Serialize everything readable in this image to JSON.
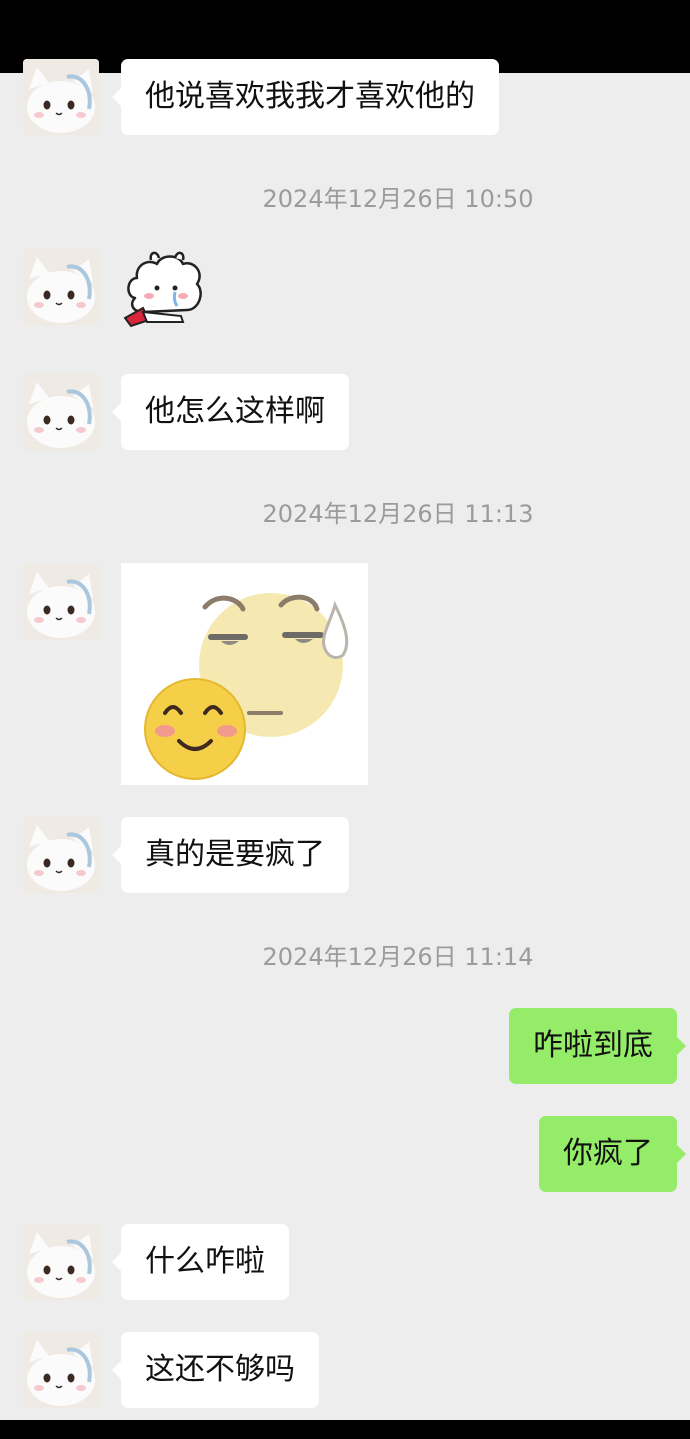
{
  "messages": {
    "m1": "他说喜欢我我才喜欢他的",
    "ts1": "2024年12月26日 10:50",
    "m2_sticker": "crying-bunny-sticker",
    "m3": "他怎么这样啊",
    "ts2": "2024年12月26日 11:13",
    "m4_sticker": "smiling-faces-sticker",
    "m5": "真的是要疯了",
    "ts3": "2024年12月26日 11:14",
    "m6": "咋啦到底",
    "m7": "你疯了",
    "m8": "什么咋啦",
    "m9": "这还不够吗"
  },
  "colors": {
    "background": "#ededed",
    "incoming_bubble": "#ffffff",
    "outgoing_bubble": "#95ec69",
    "timestamp_text": "#9b9b9b"
  },
  "icons": {
    "avatar": "white-cat-avatar-icon"
  }
}
